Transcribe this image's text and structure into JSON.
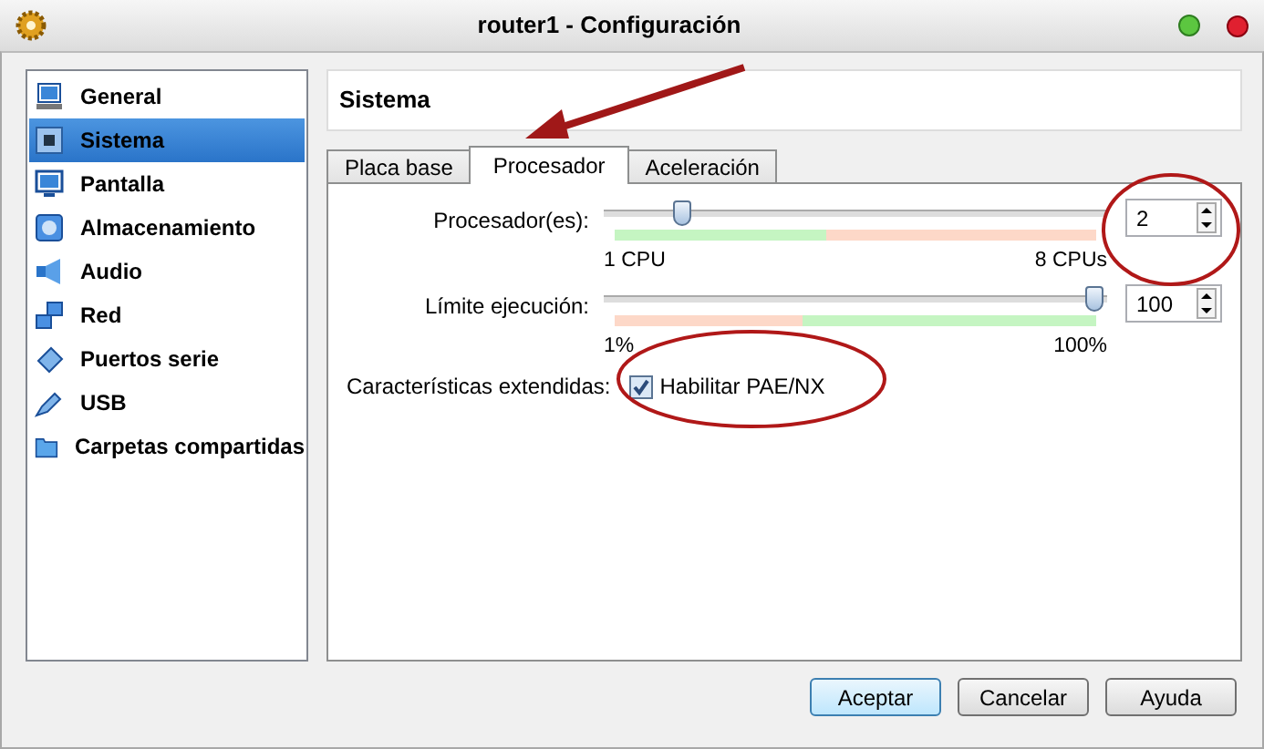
{
  "window": {
    "title": "router1 - Configuración"
  },
  "sidebar": {
    "items": [
      {
        "label": "General",
        "selected": false
      },
      {
        "label": "Sistema",
        "selected": true
      },
      {
        "label": "Pantalla",
        "selected": false
      },
      {
        "label": "Almacenamiento",
        "selected": false
      },
      {
        "label": "Audio",
        "selected": false
      },
      {
        "label": "Red",
        "selected": false
      },
      {
        "label": "Puertos serie",
        "selected": false
      },
      {
        "label": "USB",
        "selected": false
      },
      {
        "label": "Carpetas compartidas",
        "selected": false
      }
    ]
  },
  "page_title": "Sistema",
  "tabs": [
    {
      "label": "Placa base",
      "selected": false
    },
    {
      "label": "Procesador",
      "selected": true
    },
    {
      "label": "Aceleración",
      "selected": false
    }
  ],
  "sliders": [
    {
      "label": "Procesador(es):",
      "level": 0.143,
      "value": "2",
      "min_label": "1 CPU",
      "max_label": "8 CPUs"
    },
    {
      "label": "Límite ejecución:",
      "level": 1,
      "value": "100",
      "min_label": "1%",
      "max_label": "100%"
    }
  ],
  "extended": {
    "label": "Características extendidas:",
    "checkbox": {
      "label": "Habilitar PAE/NX",
      "checked": true
    }
  },
  "buttons": [
    {
      "label": "Aceptar",
      "default": true
    },
    {
      "label": "Cancelar",
      "default": false
    },
    {
      "label": "Ayuda",
      "default": false
    }
  ]
}
